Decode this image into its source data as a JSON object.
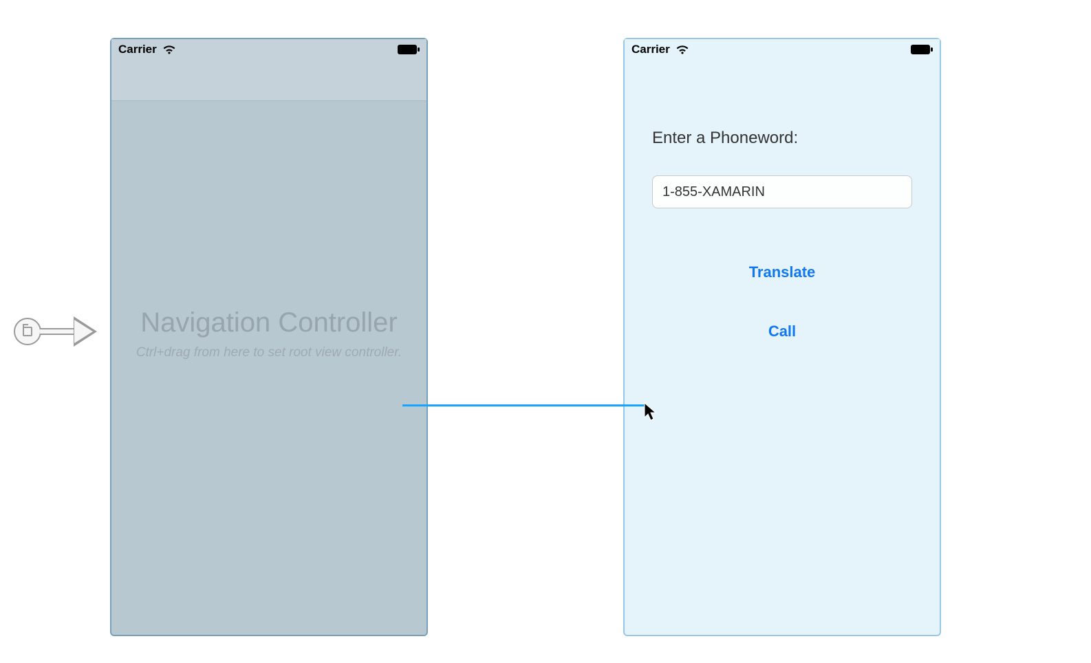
{
  "status": {
    "carrier": "Carrier"
  },
  "nav_controller": {
    "title": "Navigation Controller",
    "subtitle": "Ctrl+drag from here to set root view controller."
  },
  "view_controller": {
    "prompt_label": "Enter a Phoneword:",
    "phoneword_value": "1-855-XAMARIN",
    "translate_label": "Translate",
    "call_label": "Call"
  }
}
